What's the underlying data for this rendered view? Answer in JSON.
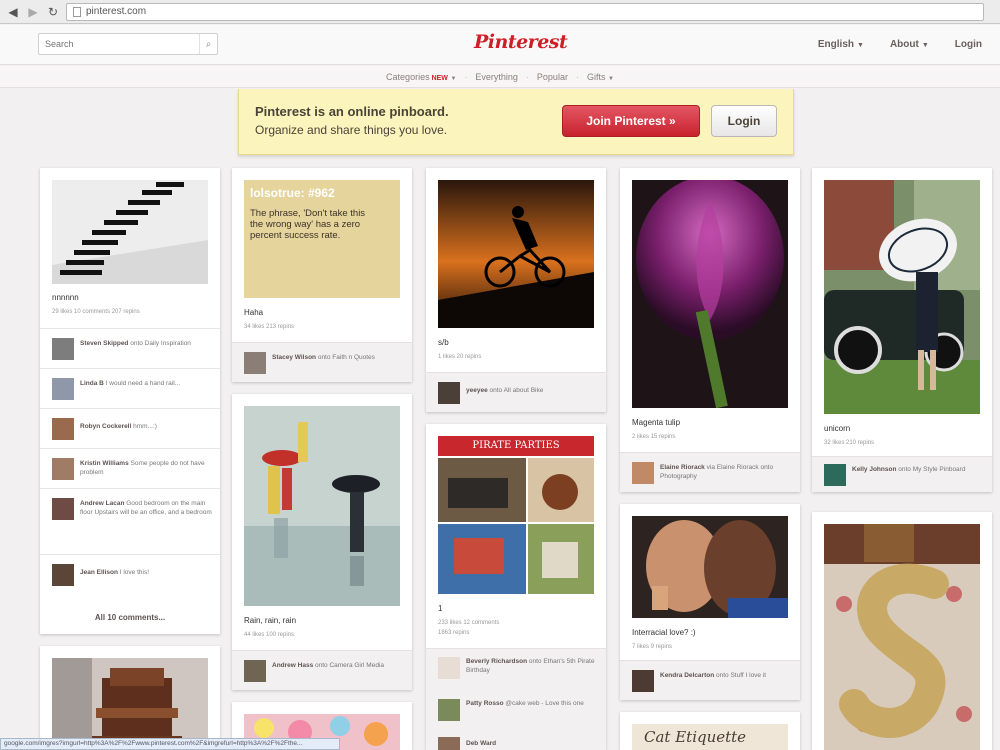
{
  "browser": {
    "url": "pinterest.com",
    "status_url": "google.com/imgres?imgurl=http%3A%2F%2Fwww.pinterest.com%2F&imgrefurl=http%3A%2F%2Fthe..."
  },
  "header": {
    "search_placeholder": "Search",
    "logo": "Pinterest",
    "language": "English",
    "about": "About",
    "login": "Login"
  },
  "subnav": {
    "categories": "Categories",
    "new_badge": "NEW",
    "everything": "Everything",
    "popular": "Popular",
    "gifts": "Gifts"
  },
  "banner": {
    "line1": "Pinterest is an online pinboard.",
    "line2": "Organize and share things you love.",
    "join": "Join Pinterest »",
    "login": "Login"
  },
  "pins": {
    "p1": {
      "desc": "nnnnnn",
      "stats": "29 likes   10 comments   207 repins",
      "comments": [
        {
          "name": "Steven Skipped",
          "text": "onto Daily Inspiration"
        },
        {
          "name": "Linda B",
          "text": "I would need a hand rail..."
        },
        {
          "name": "Robyn Cockerell",
          "text": "hmm...:)"
        },
        {
          "name": "Kristin Williams",
          "text": "Some people do not have problem"
        },
        {
          "name": "Andrew Lacan",
          "text": "Good bedroom on the main floor Upstairs will be an office, and a bedroom"
        },
        {
          "name": "Jean Ellison",
          "text": "I love this!"
        }
      ],
      "all_comments": "All 10 comments..."
    },
    "p2": {
      "quote_title": "lolsotrue: #962",
      "quote_text": "The phrase, 'Don't take this the wrong way' has a zero percent success rate.",
      "desc": "Haha",
      "stats": "34 likes   213 repins",
      "foot_name": "Stacey Wilson",
      "foot_text": "onto Faith n Quotes"
    },
    "p3": {
      "desc": "s/b",
      "stats": "1 likes   20 repins",
      "foot_name": "yeeyee",
      "foot_text": "onto All about Bike"
    },
    "p4": {
      "desc": "Magenta tulip",
      "stats": "2 likes   15 repins",
      "foot_name": "Elaine Riorack",
      "foot_text": "via Elaine Riorack onto Photography"
    },
    "p5": {
      "desc": "unicorn",
      "stats": "32 likes   210 repins",
      "foot_name": "Kelly Johnson",
      "foot_text": "onto My Style Pinboard"
    },
    "p6": {
      "desc": "Rain, rain, rain",
      "stats": "44 likes   100 repins",
      "foot_name": "Andrew Hass",
      "foot_text": "onto Camera Girl Media"
    },
    "p7": {
      "header": "PIRATE PARTIES",
      "desc": "1",
      "stats": "233 likes   12 comments",
      "stats2": "1863 repins",
      "c1_name": "Beverly Richardson",
      "c1_text": "onto Ethan's 5th Pirate Birthday",
      "c2_name": "Patty Rosso",
      "c2_text": "@cake web - Love this one",
      "c3_name": "Deb Ward",
      "c3_text": ""
    },
    "p8": {
      "desc": "Interracial love? :)",
      "stats": "7 likes   9 repins",
      "foot_name": "Kendra Delcarton",
      "foot_text": "onto Stuff I love it"
    },
    "p9": {
      "text": "Cat Etiquette"
    }
  }
}
